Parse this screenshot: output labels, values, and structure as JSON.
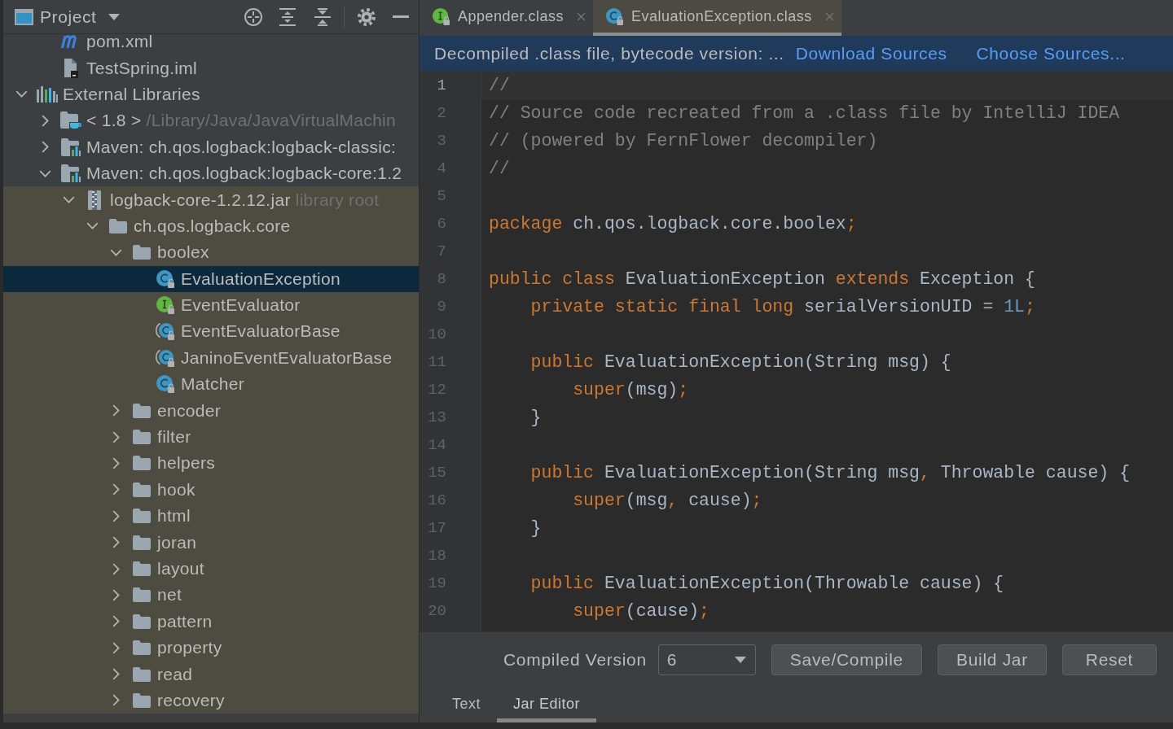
{
  "project_panel": {
    "title": "Project",
    "tree": [
      {
        "kind": "scrolled-parent",
        "children": [
          {
            "label": "pom.xml",
            "kind": "maven-file",
            "selected": false,
            "highlighted": false
          },
          {
            "label": "TestSpring.iml",
            "kind": "module-file",
            "selected": false,
            "highlighted": false
          }
        ]
      },
      {
        "label": "External Libraries",
        "kind": "libraries",
        "expanded": true,
        "selected": false,
        "highlighted": false,
        "children": [
          {
            "label": "< 1.8 >",
            "detail": "/Library/Java/JavaVirtualMachin",
            "kind": "jdk",
            "expanded": false,
            "selected": false,
            "highlighted": false
          },
          {
            "label": "Maven: ch.qos.logback:logback-classic:",
            "kind": "library",
            "expanded": false,
            "selected": false,
            "highlighted": false
          },
          {
            "label": "Maven: ch.qos.logback:logback-core:1.2",
            "kind": "library",
            "expanded": true,
            "selected": false,
            "highlighted": false,
            "children": [
              {
                "label": "logback-core-1.2.12.jar",
                "detail": "library root",
                "kind": "jar",
                "expanded": true,
                "selected": false,
                "highlighted": true,
                "children": [
                  {
                    "label": "ch.qos.logback.core",
                    "kind": "package",
                    "expanded": true,
                    "selected": false,
                    "highlighted": true,
                    "children": [
                      {
                        "label": "boolex",
                        "kind": "package",
                        "expanded": true,
                        "selected": false,
                        "highlighted": true,
                        "children": [
                          {
                            "label": "EvaluationException",
                            "kind": "class",
                            "selected": true,
                            "highlighted": true
                          },
                          {
                            "label": "EventEvaluator",
                            "kind": "interface",
                            "selected": false,
                            "highlighted": true
                          },
                          {
                            "label": "EventEvaluatorBase",
                            "kind": "abstract-class",
                            "selected": false,
                            "highlighted": true
                          },
                          {
                            "label": "JaninoEventEvaluatorBase",
                            "kind": "abstract-class",
                            "selected": false,
                            "highlighted": true
                          },
                          {
                            "label": "Matcher",
                            "kind": "class",
                            "selected": false,
                            "highlighted": true
                          }
                        ]
                      },
                      {
                        "label": "encoder",
                        "kind": "package",
                        "expanded": false,
                        "selected": false,
                        "highlighted": true
                      },
                      {
                        "label": "filter",
                        "kind": "package",
                        "expanded": false,
                        "selected": false,
                        "highlighted": true
                      },
                      {
                        "label": "helpers",
                        "kind": "package",
                        "expanded": false,
                        "selected": false,
                        "highlighted": true
                      },
                      {
                        "label": "hook",
                        "kind": "package",
                        "expanded": false,
                        "selected": false,
                        "highlighted": true
                      },
                      {
                        "label": "html",
                        "kind": "package",
                        "expanded": false,
                        "selected": false,
                        "highlighted": true
                      },
                      {
                        "label": "joran",
                        "kind": "package",
                        "expanded": false,
                        "selected": false,
                        "highlighted": true
                      },
                      {
                        "label": "layout",
                        "kind": "package",
                        "expanded": false,
                        "selected": false,
                        "highlighted": true
                      },
                      {
                        "label": "net",
                        "kind": "package",
                        "expanded": false,
                        "selected": false,
                        "highlighted": true
                      },
                      {
                        "label": "pattern",
                        "kind": "package",
                        "expanded": false,
                        "selected": false,
                        "highlighted": true
                      },
                      {
                        "label": "property",
                        "kind": "package",
                        "expanded": false,
                        "selected": false,
                        "highlighted": true
                      },
                      {
                        "label": "read",
                        "kind": "package",
                        "expanded": false,
                        "selected": false,
                        "highlighted": true
                      },
                      {
                        "label": "recovery",
                        "kind": "package",
                        "expanded": false,
                        "selected": false,
                        "highlighted": true
                      }
                    ]
                  }
                ]
              }
            ]
          }
        ]
      }
    ]
  },
  "editor_tabs": [
    {
      "label": "Appender.class",
      "kind": "interface",
      "selected": false
    },
    {
      "label": "EvaluationException.class",
      "kind": "class",
      "selected": true
    }
  ],
  "notice": {
    "text": "Decompiled .class file, bytecode version: ...",
    "links": [
      "Download Sources",
      "Choose Sources..."
    ]
  },
  "code": {
    "lines": [
      {
        "number": "1",
        "current": true,
        "tokens": [
          {
            "kind": "comment",
            "text": "//"
          }
        ]
      },
      {
        "number": "2",
        "current": false,
        "tokens": [
          {
            "kind": "comment",
            "text": "// Source code recreated from a .class file by IntelliJ IDEA"
          }
        ]
      },
      {
        "number": "3",
        "current": false,
        "tokens": [
          {
            "kind": "comment",
            "text": "// (powered by FernFlower decompiler)"
          }
        ]
      },
      {
        "number": "4",
        "current": false,
        "tokens": [
          {
            "kind": "comment",
            "text": "//"
          }
        ]
      },
      {
        "number": "5",
        "current": false
      },
      {
        "number": "6",
        "current": false,
        "tokens": [
          {
            "kind": "keyword",
            "text": "package"
          },
          {
            "kind": "plain",
            "text": " ch.qos.logback.core.boolex"
          },
          {
            "kind": "punctuation",
            "text": ";"
          }
        ]
      },
      {
        "number": "7",
        "current": false
      },
      {
        "number": "8",
        "current": false,
        "tokens": [
          {
            "kind": "keyword",
            "text": "public class"
          },
          {
            "kind": "plain",
            "text": " EvaluationException "
          },
          {
            "kind": "keyword",
            "text": "extends"
          },
          {
            "kind": "plain",
            "text": " Exception {"
          }
        ]
      },
      {
        "number": "9",
        "current": false,
        "tokens": [
          {
            "kind": "keyword",
            "text": "    private static final long"
          },
          {
            "kind": "plain",
            "text": " serialVersionUID = "
          },
          {
            "kind": "number",
            "text": "1L"
          },
          {
            "kind": "punctuation",
            "text": ";"
          }
        ]
      },
      {
        "number": "10",
        "current": false
      },
      {
        "number": "11",
        "current": false,
        "tokens": [
          {
            "kind": "keyword",
            "text": "    public"
          },
          {
            "kind": "plain",
            "text": " EvaluationException(String msg) {"
          }
        ]
      },
      {
        "number": "12",
        "current": false,
        "tokens": [
          {
            "kind": "keyword",
            "text": "        super"
          },
          {
            "kind": "plain",
            "text": "(msg)"
          },
          {
            "kind": "punctuation",
            "text": ";"
          }
        ]
      },
      {
        "number": "13",
        "current": false,
        "tokens": [
          {
            "kind": "plain",
            "text": "    }"
          }
        ]
      },
      {
        "number": "14",
        "current": false
      },
      {
        "number": "15",
        "current": false,
        "tokens": [
          {
            "kind": "keyword",
            "text": "    public"
          },
          {
            "kind": "plain",
            "text": " EvaluationException(String msg"
          },
          {
            "kind": "punctuation",
            "text": ","
          },
          {
            "kind": "plain",
            "text": " Throwable cause) {"
          }
        ]
      },
      {
        "number": "16",
        "current": false,
        "tokens": [
          {
            "kind": "keyword",
            "text": "        super"
          },
          {
            "kind": "plain",
            "text": "(msg"
          },
          {
            "kind": "punctuation",
            "text": ","
          },
          {
            "kind": "plain",
            "text": " cause)"
          },
          {
            "kind": "punctuation",
            "text": ";"
          }
        ]
      },
      {
        "number": "17",
        "current": false,
        "tokens": [
          {
            "kind": "plain",
            "text": "    }"
          }
        ]
      },
      {
        "number": "18",
        "current": false
      },
      {
        "number": "19",
        "current": false,
        "tokens": [
          {
            "kind": "keyword",
            "text": "    public"
          },
          {
            "kind": "plain",
            "text": " EvaluationException(Throwable cause) {"
          }
        ]
      },
      {
        "number": "20",
        "current": false,
        "tokens": [
          {
            "kind": "keyword",
            "text": "        super"
          },
          {
            "kind": "plain",
            "text": "(cause)"
          },
          {
            "kind": "punctuation",
            "text": ";"
          }
        ]
      }
    ]
  },
  "jar_editor": {
    "label": "Compiled Version",
    "compiled_version": "6",
    "buttons": [
      "Save/Compile",
      "Build Jar",
      "Reset"
    ],
    "tabs": [
      {
        "label": "Text",
        "selected": false
      },
      {
        "label": "Jar Editor",
        "selected": true
      }
    ]
  }
}
